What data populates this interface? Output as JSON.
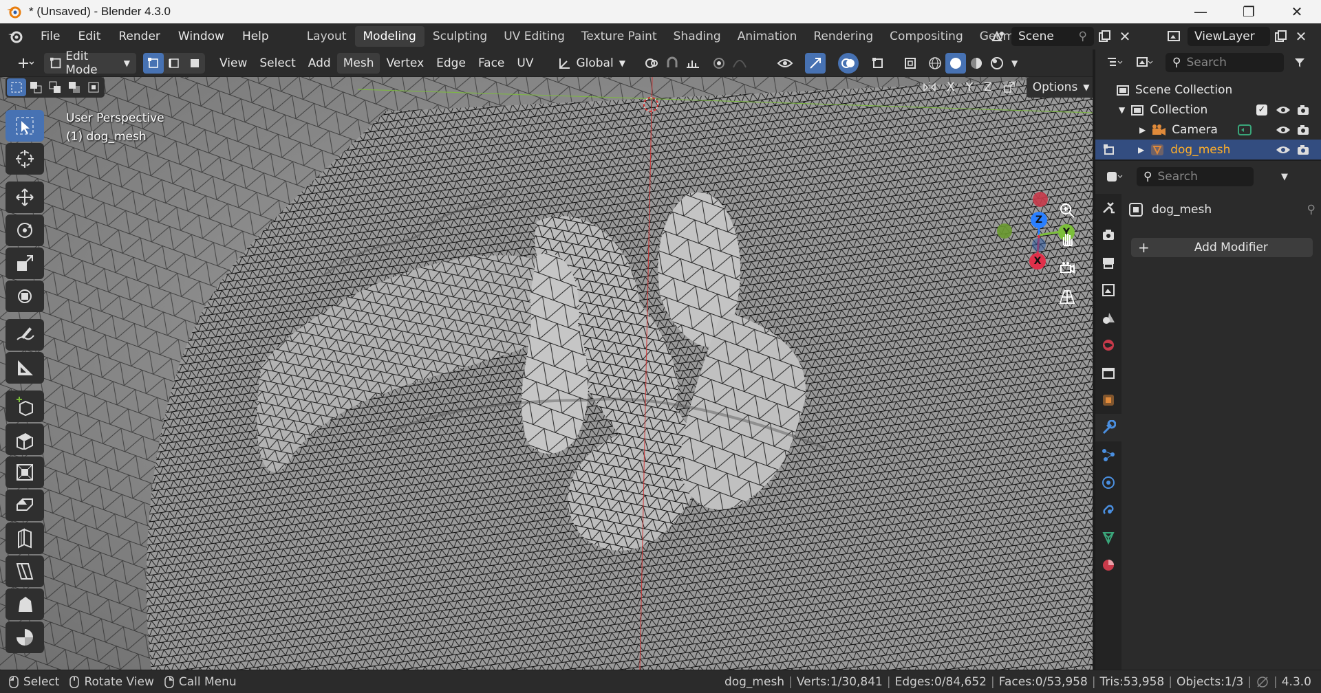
{
  "window": {
    "title": "* (Unsaved) - Blender 4.3.0",
    "controls": [
      "—",
      "❐",
      "✕"
    ]
  },
  "menus": [
    "File",
    "Edit",
    "Render",
    "Window",
    "Help"
  ],
  "workspaces": [
    "Layout",
    "Modeling",
    "Sculpting",
    "UV Editing",
    "Texture Paint",
    "Shading",
    "Animation",
    "Rendering",
    "Compositing",
    "Geome"
  ],
  "active_workspace": "Modeling",
  "scene": {
    "label": "Scene"
  },
  "viewlayer": {
    "label": "ViewLayer"
  },
  "header": {
    "mode": "Edit Mode",
    "menus": [
      "View",
      "Select",
      "Add",
      "Mesh",
      "Vertex",
      "Edge",
      "Face",
      "UV"
    ],
    "active_menu": "Mesh",
    "orientation": "Global",
    "axes": [
      "X",
      "Y",
      "Z"
    ],
    "options_label": "Options"
  },
  "viewport": {
    "perspective": "User Perspective",
    "object": "(1) dog_mesh",
    "gizmo": {
      "z": "Z",
      "y": "Y",
      "x": "X"
    }
  },
  "outliner": {
    "search_placeholder": "Search",
    "scene_collection": "Scene Collection",
    "collection": "Collection",
    "items": [
      {
        "name": "Camera",
        "selected": false
      },
      {
        "name": "dog_mesh",
        "selected": true
      }
    ]
  },
  "properties": {
    "search_placeholder": "Search",
    "object_name": "dog_mesh",
    "add_modifier": "Add Modifier"
  },
  "status": {
    "hints": [
      "Select",
      "Rotate View",
      "Call Menu"
    ],
    "object": "dog_mesh",
    "verts": "Verts:1/30,841",
    "edges": "Edges:0/84,652",
    "faces": "Faces:0/53,958",
    "tris": "Tris:53,958",
    "objects": "Objects:1/3",
    "version": "4.3.0"
  },
  "colors": {
    "accent": "#4772b3",
    "selected_text": "#ffaf29",
    "selection_row": "#334d80"
  }
}
